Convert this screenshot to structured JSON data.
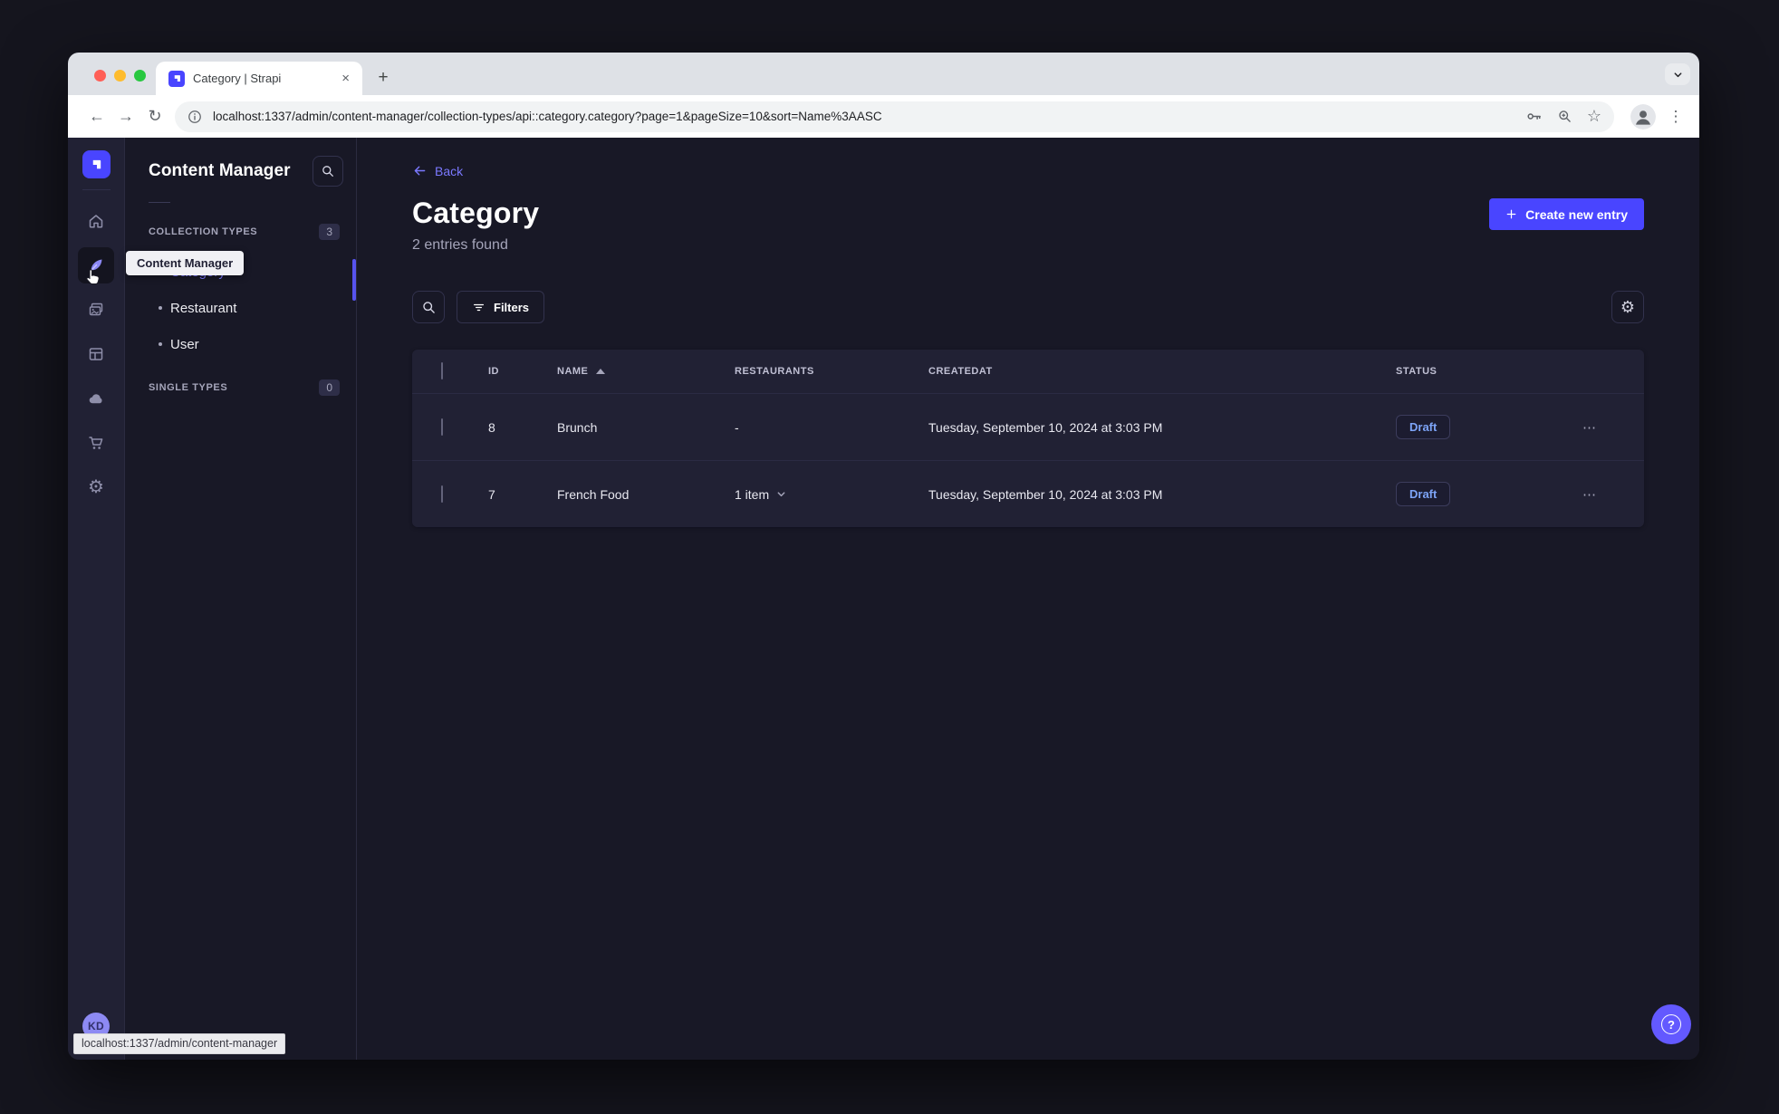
{
  "browser": {
    "tab_title": "Category | Strapi",
    "url": "localhost:1337/admin/content-manager/collection-types/api::category.category?page=1&pageSize=10&sort=Name%3AASC",
    "status_bar": "localhost:1337/admin/content-manager",
    "glyphs": {
      "back": "←",
      "forward": "→",
      "reload": "↻",
      "star": "☆",
      "menu": "⋮",
      "close": "×",
      "new_tab": "+"
    }
  },
  "sidebar": {
    "tooltip": "Content Manager",
    "icons": [
      "strapi-logo",
      "home",
      "content-manager",
      "media-library",
      "content-type-builder",
      "cloud",
      "marketplace",
      "settings"
    ],
    "active_item": "content-manager",
    "avatar_initials": "KD",
    "gear_glyph": "⚙"
  },
  "subnav": {
    "title": "Content Manager",
    "sections": [
      {
        "label": "COLLECTION TYPES",
        "badge": "3"
      },
      {
        "label": "SINGLE TYPES",
        "badge": "0"
      }
    ],
    "collection_items": [
      {
        "label": "Category",
        "active": true
      },
      {
        "label": "Restaurant",
        "active": false
      },
      {
        "label": "User",
        "active": false
      }
    ]
  },
  "main": {
    "back_label": "Back",
    "title": "Category",
    "subtitle": "2 entries found",
    "create_button": "Create new entry",
    "filters_button": "Filters",
    "gear_glyph": "⚙",
    "row_menu_glyph": "⋯",
    "help_glyph": "?",
    "table": {
      "headers": {
        "id": "ID",
        "name": "NAME",
        "restaurants": "RESTAURANTS",
        "createdat": "CREATEDAT",
        "status": "STATUS"
      },
      "rows": [
        {
          "id": "8",
          "name": "Brunch",
          "restaurants": "-",
          "createdat": "Tuesday, September 10, 2024 at 3:03 PM",
          "status": "Draft"
        },
        {
          "id": "7",
          "name": "French Food",
          "restaurants": "1 item",
          "createdat": "Tuesday, September 10, 2024 at 3:03 PM",
          "status": "Draft"
        }
      ]
    }
  },
  "colors": {
    "primary": "#4945ff",
    "primary_light": "#7b79ff",
    "app_bg": "#181826",
    "sidebar_bg": "#212134",
    "card_bg": "#212134",
    "border": "#32324d",
    "draft_text": "#7da4f7",
    "traffic_red": "#ff5f57",
    "traffic_yellow": "#febc2e",
    "traffic_green": "#28c840"
  }
}
